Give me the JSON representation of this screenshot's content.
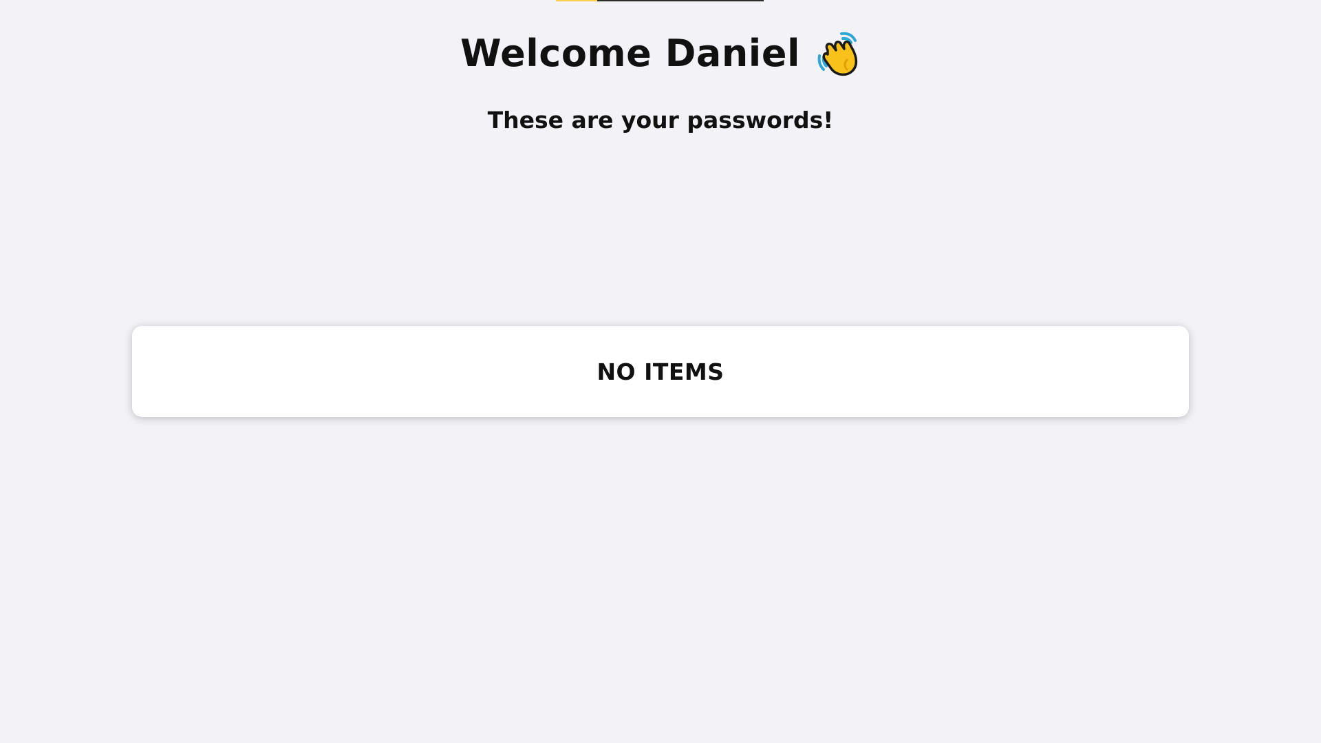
{
  "header": {
    "welcome_title": "Welcome Daniel",
    "wave_icon": "waving-hand-icon",
    "subtitle": "These are your passwords!"
  },
  "passwords": {
    "items": [],
    "empty_label": "NO ITEMS"
  },
  "colors": {
    "background": "#f2f2f7",
    "card": "#ffffff",
    "text": "#111111",
    "accent_yellow": "#f7d14a"
  }
}
